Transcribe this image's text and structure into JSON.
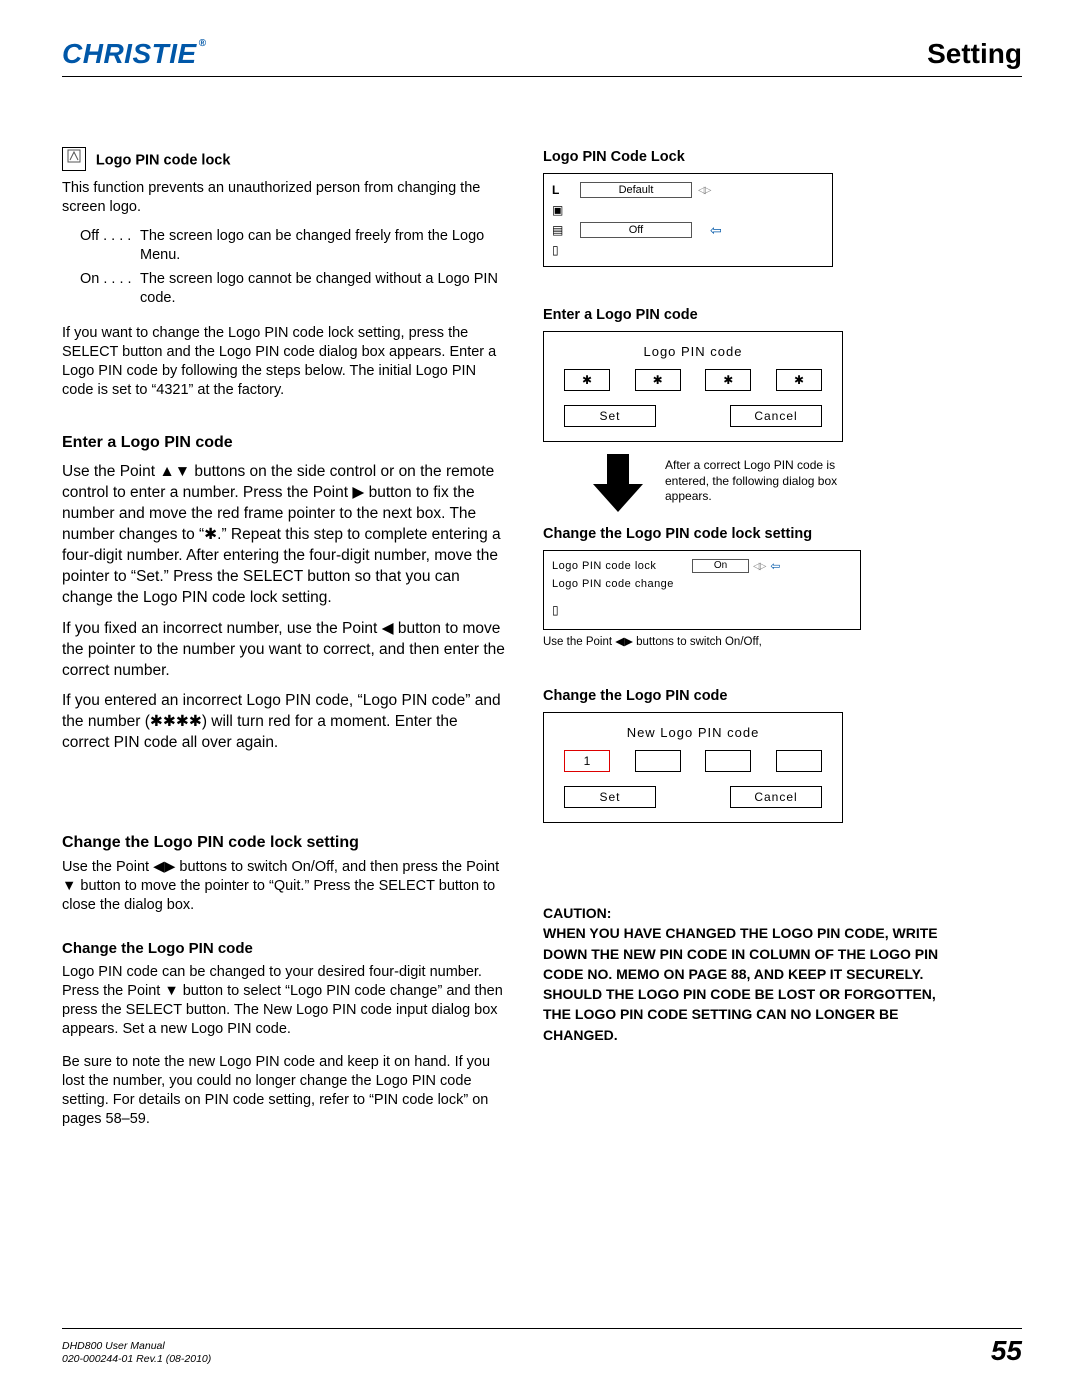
{
  "header": {
    "brand": "CHRISTIE",
    "reg": "®",
    "section": "Setting"
  },
  "s1": {
    "title": "Logo PIN code lock",
    "body": "This function prevents an unauthorized person from changing the screen logo.",
    "off_lbl": "Off . . . .",
    "off_txt": "The screen logo can be changed freely from the Logo Menu.",
    "on_lbl": "On . . . .",
    "on_txt": "The screen logo cannot be changed without a Logo PIN code.",
    "p2": "If you want to change the Logo PIN code lock setting, press the SELECT button and the Logo PIN code dialog box appears. Enter a Logo PIN code by following the steps below. The initial Logo PIN code is set to “4321” at the factory."
  },
  "s2": {
    "title": "Enter a Logo PIN code",
    "p1a": "Use the Point ",
    "p1b": " buttons on the side control or on the remote control to enter a number. Press the Point ",
    "p1c": " button to fix the number and move the red frame pointer to the next box. The number changes to “✱.” Repeat this step to complete entering a four-digit number. After entering the four-digit number, move the pointer to “Set.” Press the SELECT button so that you can change the Logo PIN code lock setting.",
    "p2a": " If you fixed an incorrect number, use the Point ",
    "p2b": " button to move the pointer to the number you want to correct, and then enter the correct number.",
    "p3": "If you entered an incorrect Logo PIN code, “Logo PIN code” and the number (✱✱✱✱) will turn red for a moment. Enter the correct PIN code all over again."
  },
  "s3": {
    "title": "Change the Logo PIN code lock setting",
    "p1a": "Use the Point ",
    "p1b": " buttons to switch On/Off, and then press the Point ",
    "p1c": " button to move the pointer to “Quit.” Press the SELECT button to close the dialog box."
  },
  "s4": {
    "title": "Change the Logo PIN code",
    "p1a": "Logo PIN code can be changed to your desired four-digit number. Press the Point ",
    "p1b": " button to select “Logo PIN code change” and then press the SELECT button. The New Logo PIN code input dialog box appears. Set a new Logo PIN code.",
    "p2": "Be sure to note the new Logo PIN code and keep it on hand. If you lost the number, you could no longer change the Logo PIN code setting. For details on PIN code setting, refer to “PIN code lock” on pages 58–59."
  },
  "r": {
    "t1": "Logo PIN Code Lock",
    "default": "Default",
    "off": "Off",
    "t2": "Enter a Logo PIN code",
    "dlg1_title": "Logo PIN code",
    "star": "✱",
    "set": "Set",
    "cancel": "Cancel",
    "arrow_text": "After a correct Logo PIN code is entered, the following dialog box appears.",
    "t3": "Change the Logo PIN code lock setting",
    "lock_l1": "Logo PIN code lock",
    "lock_v1": "On",
    "lock_l2": "Logo PIN code change",
    "note_a": "Use the Point ",
    "note_b": " buttons to switch On/Off,",
    "t4": "Change the Logo PIN code",
    "dlg2_title": "New Logo PIN code",
    "one": "1",
    "caution_lbl": "CAUTION:",
    "caution": "WHEN YOU HAVE CHANGED THE LOGO PIN CODE, WRITE DOWN THE NEW PIN CODE IN COLUMN OF THE LOGO PIN CODE NO. MEMO ON PAGE 88, AND KEEP IT SECURELY. SHOULD THE LOGO PIN CODE BE LOST OR FORGOTTEN, THE LOGO PIN CODE SETTING CAN NO LONGER BE CHANGED."
  },
  "footer": {
    "l1": "DHD800 User Manual",
    "l2": "020-000244-01 Rev.1 (08-2010)",
    "page": "55"
  }
}
